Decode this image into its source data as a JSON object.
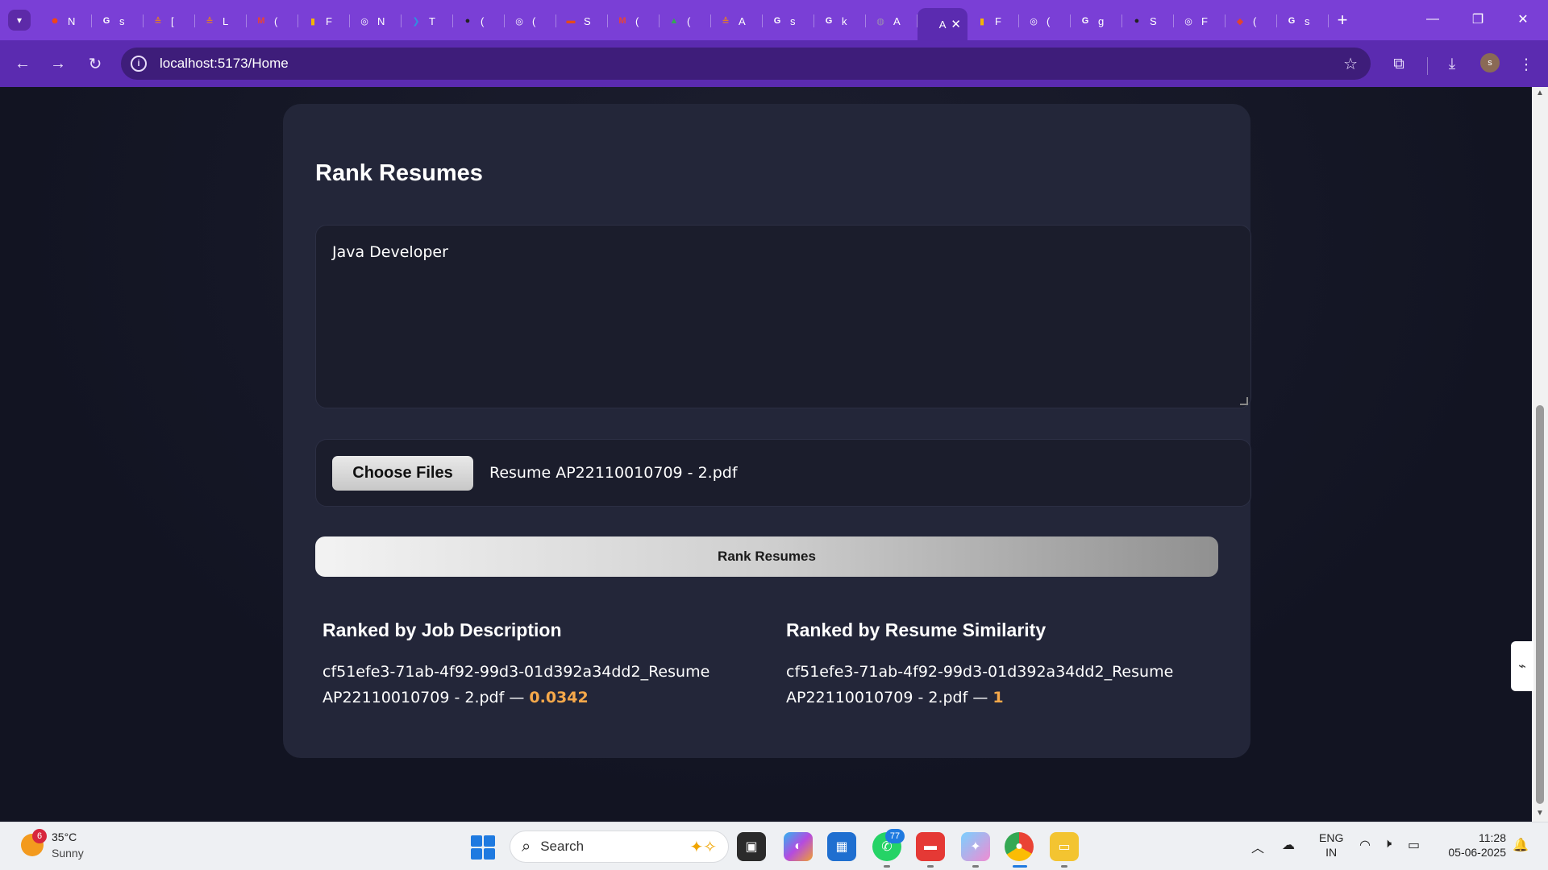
{
  "browser": {
    "tabs": [
      {
        "label": "N",
        "icon": "reddit-icon",
        "color": "#ff4500",
        "glyph": "☻"
      },
      {
        "label": "s",
        "icon": "google-icon",
        "color": "#ffffff",
        "glyph": "G"
      },
      {
        "label": "[",
        "icon": "ai-logo-icon",
        "color": "#e07a2e",
        "glyph": "≙"
      },
      {
        "label": "L",
        "icon": "ai-logo-icon",
        "color": "#e07a2e",
        "glyph": "≙"
      },
      {
        "label": "(",
        "icon": "gmail-icon",
        "color": "#ea4335",
        "glyph": "M"
      },
      {
        "label": "F",
        "icon": "chart-icon",
        "color": "#f4b400",
        "glyph": "▮"
      },
      {
        "label": "N",
        "icon": "openai-icon",
        "color": "#ffffff",
        "glyph": "◎"
      },
      {
        "label": "T",
        "icon": "vscode-icon",
        "color": "#2f8fe0",
        "glyph": "❯"
      },
      {
        "label": "(",
        "icon": "github-icon",
        "color": "#222222",
        "glyph": "●"
      },
      {
        "label": "(",
        "icon": "openai-icon",
        "color": "#ffffff",
        "glyph": "◎"
      },
      {
        "label": "S",
        "icon": "slides-icon",
        "color": "#e64a19",
        "glyph": "▬"
      },
      {
        "label": "(",
        "icon": "gmail-icon",
        "color": "#ea4335",
        "glyph": "M"
      },
      {
        "label": "(",
        "icon": "drive-icon",
        "color": "#34a853",
        "glyph": "▲"
      },
      {
        "label": "A",
        "icon": "ai-logo-icon",
        "color": "#e07a2e",
        "glyph": "≙"
      },
      {
        "label": "s",
        "icon": "google-icon",
        "color": "#ffffff",
        "glyph": "G"
      },
      {
        "label": "k",
        "icon": "google-icon",
        "color": "#ffffff",
        "glyph": "G"
      },
      {
        "label": "A",
        "icon": "globe-icon",
        "color": "#9a8fb0",
        "glyph": "◍"
      },
      {
        "label": "A",
        "icon": "globe-icon",
        "color": "#9a8fb0",
        "glyph": "",
        "active": true
      },
      {
        "label": "F",
        "icon": "chart-icon",
        "color": "#f4b400",
        "glyph": "▮"
      },
      {
        "label": "(",
        "icon": "openai-icon",
        "color": "#ffffff",
        "glyph": "◎"
      },
      {
        "label": "g",
        "icon": "google-icon",
        "color": "#ffffff",
        "glyph": "G"
      },
      {
        "label": "S",
        "icon": "github-icon",
        "color": "#222222",
        "glyph": "●"
      },
      {
        "label": "F",
        "icon": "openai-icon",
        "color": "#ffffff",
        "glyph": "◎"
      },
      {
        "label": "(",
        "icon": "git-icon",
        "color": "#e2442f",
        "glyph": "◆"
      },
      {
        "label": "s",
        "icon": "google-icon",
        "color": "#ffffff",
        "glyph": "G"
      }
    ],
    "url": "localhost:5173/Home",
    "profile_initial": "s"
  },
  "app": {
    "title": "Rank Resumes",
    "job_description": "Java Developer",
    "choose_files_label": "Choose Files",
    "selected_file": "Resume AP22110010709 - 2.pdf",
    "rank_button_label": "Rank Resumes",
    "results": {
      "by_job": {
        "heading": "Ranked by Job Description",
        "items": [
          {
            "name": "cf51efe3-71ab-4f92-99d3-01d392a34dd2_Resume AP22110010709 - 2.pdf —",
            "score": "0.0342"
          }
        ]
      },
      "by_similarity": {
        "heading": "Ranked by Resume Similarity",
        "items": [
          {
            "name": "cf51efe3-71ab-4f92-99d3-01d392a34dd2_Resume AP22110010709 - 2.pdf —",
            "score": "1"
          }
        ]
      }
    },
    "accent_color": "#f5a84a"
  },
  "taskbar": {
    "weather": {
      "temp": "35°C",
      "desc": "Sunny",
      "badge": "6"
    },
    "search_placeholder": "Search",
    "whatsapp_badge": "77",
    "lang": {
      "line1": "ENG",
      "line2": "IN"
    },
    "clock": {
      "time": "11:28",
      "date": "05-06-2025"
    }
  }
}
